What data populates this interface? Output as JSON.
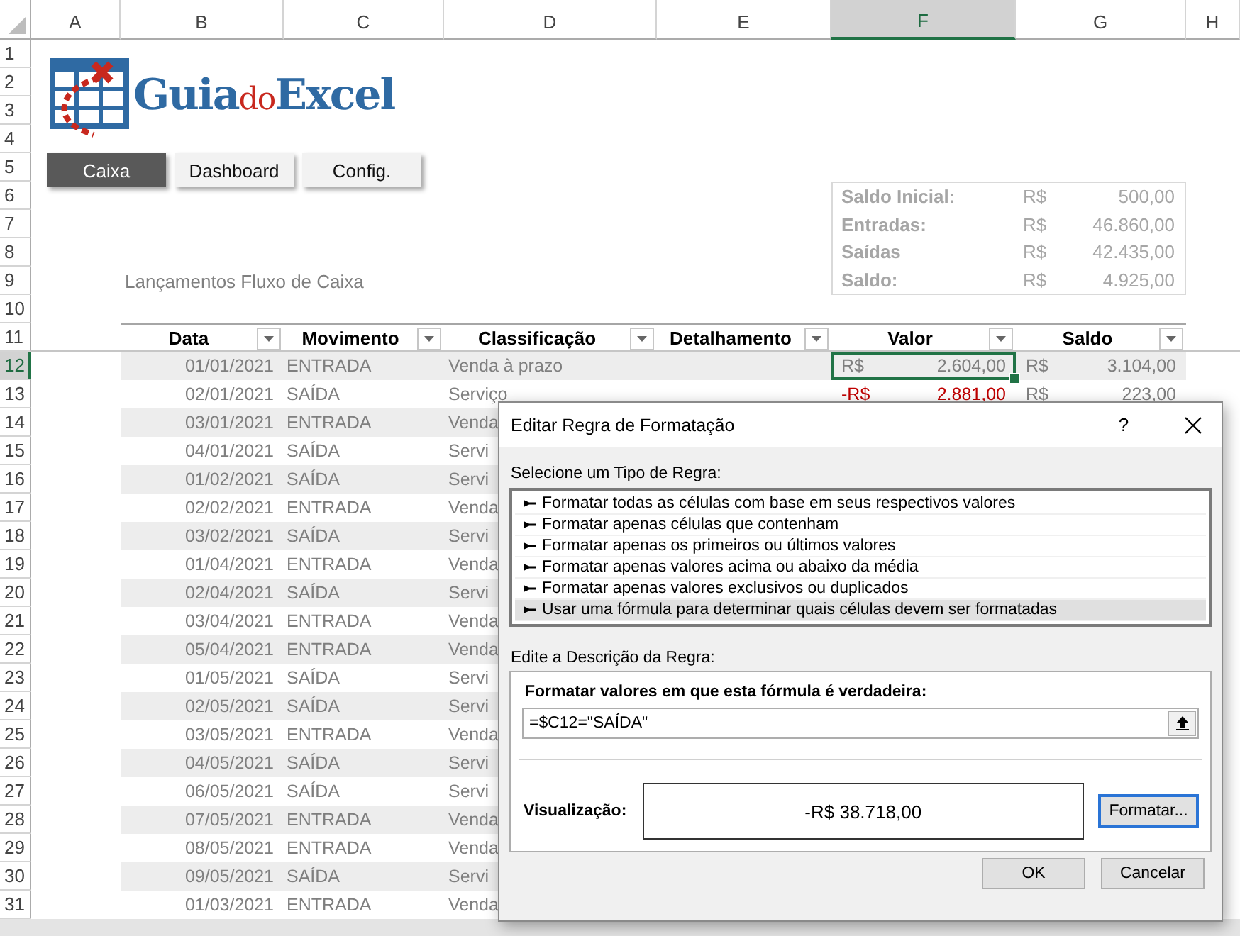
{
  "column_headers": [
    {
      "label": "A",
      "selected": false
    },
    {
      "label": "B",
      "selected": false
    },
    {
      "label": "C",
      "selected": false
    },
    {
      "label": "D",
      "selected": false
    },
    {
      "label": "E",
      "selected": false
    },
    {
      "label": "F",
      "selected": true
    },
    {
      "label": "G",
      "selected": false
    },
    {
      "label": "H",
      "selected": false
    }
  ],
  "row_headers": [
    {
      "label": "1",
      "selected": false
    },
    {
      "label": "2",
      "selected": false
    },
    {
      "label": "3",
      "selected": false
    },
    {
      "label": "4",
      "selected": false
    },
    {
      "label": "5",
      "selected": false
    },
    {
      "label": "6",
      "selected": false
    },
    {
      "label": "7",
      "selected": false
    },
    {
      "label": "8",
      "selected": false
    },
    {
      "label": "9",
      "selected": false
    },
    {
      "label": "10",
      "selected": false
    },
    {
      "label": "11",
      "selected": false
    },
    {
      "label": "12",
      "selected": true
    },
    {
      "label": "13",
      "selected": false
    },
    {
      "label": "14",
      "selected": false
    },
    {
      "label": "15",
      "selected": false
    },
    {
      "label": "16",
      "selected": false
    },
    {
      "label": "17",
      "selected": false
    },
    {
      "label": "18",
      "selected": false
    },
    {
      "label": "19",
      "selected": false
    },
    {
      "label": "20",
      "selected": false
    },
    {
      "label": "21",
      "selected": false
    },
    {
      "label": "22",
      "selected": false
    },
    {
      "label": "23",
      "selected": false
    },
    {
      "label": "24",
      "selected": false
    },
    {
      "label": "25",
      "selected": false
    },
    {
      "label": "26",
      "selected": false
    },
    {
      "label": "27",
      "selected": false
    },
    {
      "label": "28",
      "selected": false
    },
    {
      "label": "29",
      "selected": false
    },
    {
      "label": "30",
      "selected": false
    },
    {
      "label": "31",
      "selected": false
    }
  ],
  "logo": {
    "part_1": "Guia",
    "part_2": "do",
    "part_3": "Excel"
  },
  "nav_buttons": [
    {
      "label": "Caixa",
      "selected": true
    },
    {
      "label": "Dashboard",
      "selected": false
    },
    {
      "label": "Config.",
      "selected": false
    }
  ],
  "summary": [
    {
      "label": "Saldo Inicial:",
      "currency": "R$",
      "amount": "500,00"
    },
    {
      "label": "Entradas:",
      "currency": "R$",
      "amount": "46.860,00"
    },
    {
      "label": "Saídas",
      "currency": "R$",
      "amount": "42.435,00"
    },
    {
      "label": "Saldo:",
      "currency": "R$",
      "amount": "4.925,00"
    }
  ],
  "table": {
    "title": "Lançamentos Fluxo de Caixa",
    "columns": [
      "Data",
      "Movimento",
      "Classificação",
      "Detalhamento",
      "Valor",
      "Saldo"
    ],
    "rows": [
      {
        "date": "01/01/2021",
        "movement": "ENTRADA",
        "classification": "Venda à prazo",
        "value": {
          "currency": "R$",
          "amount": "2.604,00",
          "negative": false
        },
        "balance": {
          "currency": "R$",
          "amount": "3.104,00"
        },
        "selected": true
      },
      {
        "date": "02/01/2021",
        "movement": "SAÍDA",
        "classification": "Serviço",
        "value": {
          "currency": "-R$",
          "amount": "2.881,00",
          "negative": true
        },
        "balance": {
          "currency": "R$",
          "amount": "223,00"
        },
        "selected": false
      },
      {
        "date": "03/01/2021",
        "movement": "ENTRADA",
        "classification": "Venda"
      },
      {
        "date": "04/01/2021",
        "movement": "SAÍDA",
        "classification": "Servi"
      },
      {
        "date": "01/02/2021",
        "movement": "SAÍDA",
        "classification": "Servi"
      },
      {
        "date": "02/02/2021",
        "movement": "ENTRADA",
        "classification": "Venda"
      },
      {
        "date": "03/02/2021",
        "movement": "SAÍDA",
        "classification": "Servi"
      },
      {
        "date": "01/04/2021",
        "movement": "ENTRADA",
        "classification": "Venda"
      },
      {
        "date": "02/04/2021",
        "movement": "SAÍDA",
        "classification": "Servi"
      },
      {
        "date": "03/04/2021",
        "movement": "ENTRADA",
        "classification": "Venda"
      },
      {
        "date": "05/04/2021",
        "movement": "ENTRADA",
        "classification": "Venda"
      },
      {
        "date": "01/05/2021",
        "movement": "SAÍDA",
        "classification": "Servi"
      },
      {
        "date": "02/05/2021",
        "movement": "SAÍDA",
        "classification": "Servi"
      },
      {
        "date": "03/05/2021",
        "movement": "ENTRADA",
        "classification": "Venda"
      },
      {
        "date": "04/05/2021",
        "movement": "SAÍDA",
        "classification": "Servi"
      },
      {
        "date": "06/05/2021",
        "movement": "SAÍDA",
        "classification": "Servi"
      },
      {
        "date": "07/05/2021",
        "movement": "ENTRADA",
        "classification": "Venda"
      },
      {
        "date": "08/05/2021",
        "movement": "ENTRADA",
        "classification": "Venda"
      },
      {
        "date": "09/05/2021",
        "movement": "SAÍDA",
        "classification": "Servi"
      },
      {
        "date": "01/03/2021",
        "movement": "ENTRADA",
        "classification": "Venda"
      }
    ]
  },
  "dialog": {
    "title": "Editar Regra de Formatação",
    "help": "?",
    "type_label": "Selecione um Tipo de Regra:",
    "rule_types": [
      {
        "label": "Formatar todas as células com base em seus respectivos valores",
        "selected": false
      },
      {
        "label": "Formatar apenas células que contenham",
        "selected": false
      },
      {
        "label": "Formatar apenas os primeiros ou últimos valores",
        "selected": false
      },
      {
        "label": "Formatar apenas valores acima ou abaixo da média",
        "selected": false
      },
      {
        "label": "Formatar apenas valores exclusivos ou duplicados",
        "selected": false
      },
      {
        "label": "Usar uma fórmula para determinar quais células devem ser formatadas",
        "selected": true
      }
    ],
    "description_label": "Edite a Descrição da Regra:",
    "formula_label": "Formatar valores em que esta fórmula é verdadeira:",
    "formula": {
      "value": "=$C12=\"SAÍDA\""
    },
    "preview_label": "Visualização:",
    "preview": "-R$ 38.718,00",
    "format_button": "Formatar...",
    "buttons": [
      "OK",
      "Cancelar"
    ]
  }
}
